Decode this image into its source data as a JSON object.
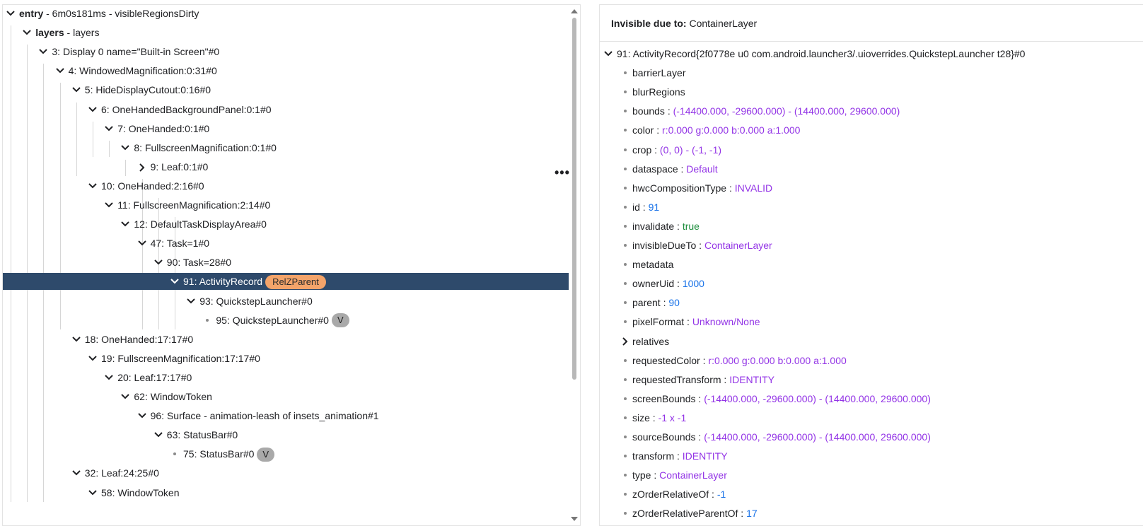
{
  "tree": {
    "rows": [
      {
        "bold": "entry",
        "text": " - 6m0s181ms - visibleRegionsDirty"
      },
      {
        "bold": "layers",
        "text": " - layers"
      },
      {
        "text": "3: Display 0 name=\"Built-in Screen\"#0"
      },
      {
        "text": "4: WindowedMagnification:0:31#0"
      },
      {
        "text": "5: HideDisplayCutout:0:16#0"
      },
      {
        "text": "6: OneHandedBackgroundPanel:0:1#0"
      },
      {
        "text": "7: OneHanded:0:1#0"
      },
      {
        "text": "8: FullscreenMagnification:0:1#0"
      },
      {
        "text": "9: Leaf:0:1#0"
      },
      {
        "text": "10: OneHanded:2:16#0"
      },
      {
        "text": "11: FullscreenMagnification:2:14#0"
      },
      {
        "text": "12: DefaultTaskDisplayArea#0"
      },
      {
        "text": "47: Task=1#0"
      },
      {
        "text": "90: Task=28#0"
      },
      {
        "text": "91: ActivityRecord",
        "chip": "RelZParent"
      },
      {
        "text": "93: QuickstepLauncher#0"
      },
      {
        "text": "95: QuickstepLauncher#0",
        "chip": "V"
      },
      {
        "text": "18: OneHanded:17:17#0"
      },
      {
        "text": "19: FullscreenMagnification:17:17#0"
      },
      {
        "text": "20: Leaf:17:17#0"
      },
      {
        "text": "62: WindowToken"
      },
      {
        "text": "96: Surface - animation-leash of insets_animation#1"
      },
      {
        "text": "63: StatusBar#0"
      },
      {
        "text": "75: StatusBar#0",
        "chip": "V"
      },
      {
        "text": "32: Leaf:24:25#0"
      },
      {
        "text": "58: WindowToken"
      }
    ],
    "more_icon": "more-horiz-icon"
  },
  "props": {
    "header_label": "Invisible due to:",
    "header_value": "ContainerLayer",
    "root": "91: ActivityRecord{2f0778e u0 com.android.launcher3/.uioverrides.QuickstepLauncher t28}#0",
    "items": [
      {
        "key": "barrierLayer",
        "value": ""
      },
      {
        "key": "blurRegions",
        "value": ""
      },
      {
        "key": "bounds",
        "value": "(-14400.000, -29600.000) - (14400.000, 29600.000)"
      },
      {
        "key": "color",
        "value": "r:0.000 g:0.000 b:0.000 a:1.000"
      },
      {
        "key": "crop",
        "value": "(0, 0) - (-1, -1)"
      },
      {
        "key": "dataspace",
        "value": "Default"
      },
      {
        "key": "hwcCompositionType",
        "value": "INVALID"
      },
      {
        "key": "id",
        "value": "91"
      },
      {
        "key": "invalidate",
        "value": "true"
      },
      {
        "key": "invisibleDueTo",
        "value": "ContainerLayer"
      },
      {
        "key": "metadata",
        "value": ""
      },
      {
        "key": "ownerUid",
        "value": "1000"
      },
      {
        "key": "parent",
        "value": "90"
      },
      {
        "key": "pixelFormat",
        "value": "Unknown/None"
      },
      {
        "key": "relatives",
        "value": ""
      },
      {
        "key": "requestedColor",
        "value": "r:0.000 g:0.000 b:0.000 a:1.000"
      },
      {
        "key": "requestedTransform",
        "value": "IDENTITY"
      },
      {
        "key": "screenBounds",
        "value": "(-14400.000, -29600.000) - (14400.000, 29600.000)"
      },
      {
        "key": "size",
        "value": "-1 x -1"
      },
      {
        "key": "sourceBounds",
        "value": "(-14400.000, -29600.000) - (14400.000, 29600.000)"
      },
      {
        "key": "transform",
        "value": "IDENTITY"
      },
      {
        "key": "type",
        "value": "ContainerLayer"
      },
      {
        "key": "zOrderRelativeOf",
        "value": "-1"
      },
      {
        "key": "zOrderRelativeParentOf",
        "value": "17"
      }
    ]
  },
  "colors": {
    "selected_row": "#2e4a6b",
    "chip_orange": "#f4a46a",
    "chip_grey": "#a9a9a9",
    "value_purple": "#9334e6",
    "value_blue": "#1a73e8",
    "value_green": "#1e8e3e"
  }
}
